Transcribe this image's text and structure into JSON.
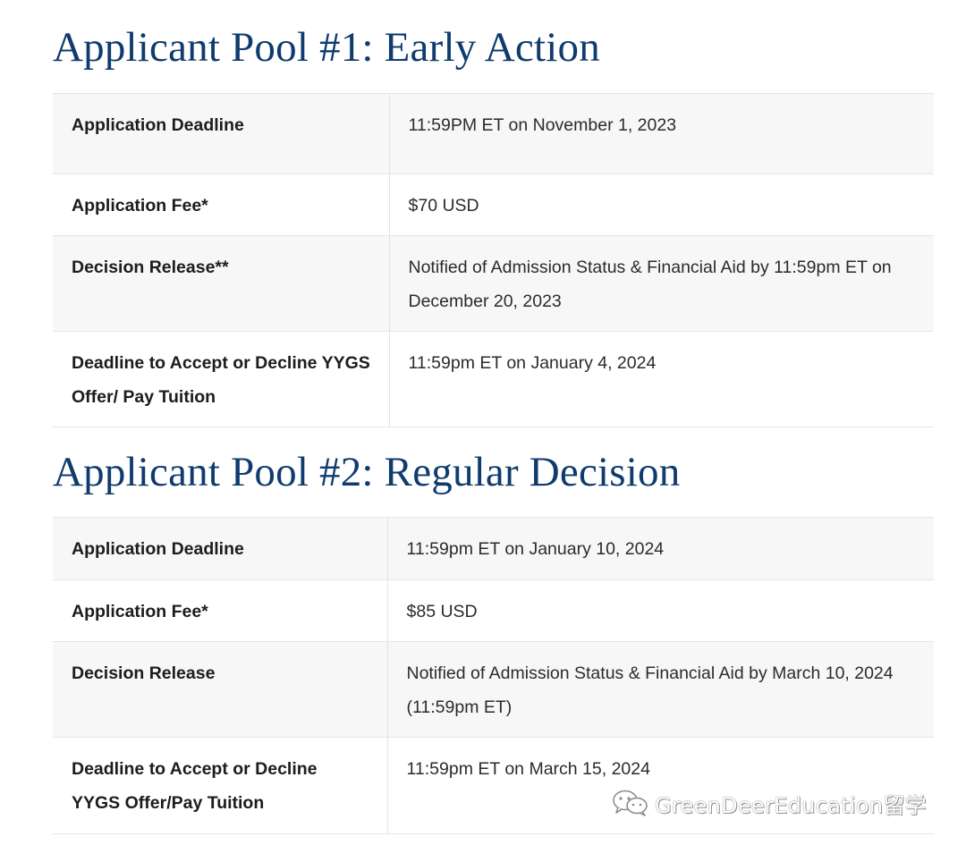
{
  "sections": [
    {
      "title": "Applicant Pool #1: Early Action",
      "rows": [
        {
          "label": "Application Deadline",
          "value": "11:59PM ET on November 1, 2023"
        },
        {
          "label": "Application Fee*",
          "value": "$70 USD"
        },
        {
          "label": "Decision Release**",
          "value": "Notified of Admission Status & Financial Aid by 11:59pm ET on December 20, 2023"
        },
        {
          "label": "Deadline to Accept or Decline YYGS Offer/ Pay Tuition",
          "value": "11:59pm ET on January 4, 2024"
        }
      ]
    },
    {
      "title": "Applicant Pool #2: Regular Decision",
      "rows": [
        {
          "label": "Application Deadline",
          "value": "11:59pm ET on January 10, 2024"
        },
        {
          "label": "Application Fee*",
          "value": "$85 USD"
        },
        {
          "label": "Decision Release",
          "value": "Notified of Admission Status & Financial Aid by March 10, 2024 (11:59pm ET)"
        },
        {
          "label": "Deadline to Accept or Decline YYGS Offer/Pay Tuition",
          "value": "11:59pm ET on March 15, 2024"
        }
      ]
    }
  ],
  "watermark": {
    "text": "GreenDeerEducation留学",
    "icon": "wechat-icon"
  },
  "colors": {
    "title": "#0f3b6e",
    "row_shade": "#f7f7f7",
    "border": "#e6e6e6"
  }
}
